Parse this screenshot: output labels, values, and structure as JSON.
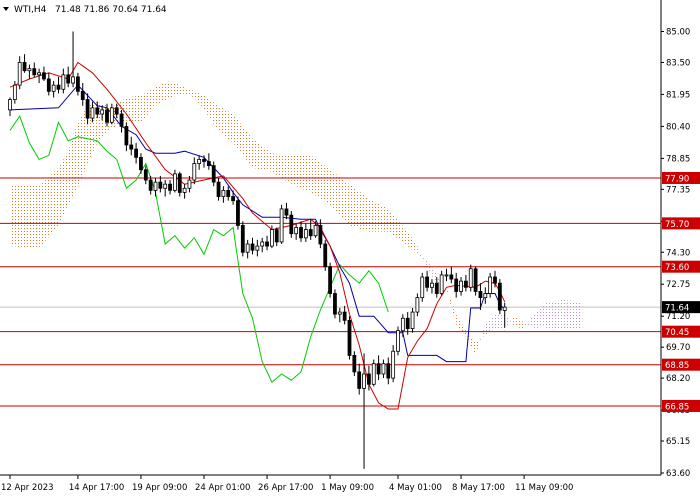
{
  "header": {
    "symbol": "WTI,H4",
    "ohlc": "71.48 71.86 70.64 71.64"
  },
  "chart_data": {
    "type": "candlestick",
    "instrument": "WTI",
    "timeframe": "H4",
    "last_price": 71.64,
    "ylim": [
      63.6,
      85.8
    ],
    "y_ticks": [
      "85.00",
      "83.50",
      "81.95",
      "80.40",
      "78.85",
      "77.35",
      "75.80",
      "74.30",
      "72.75",
      "71.20",
      "69.70",
      "68.20",
      "66.65",
      "65.15",
      "63.60"
    ],
    "x_ticks": [
      {
        "label": "12 Apr 2023",
        "index": 0
      },
      {
        "label": "14 Apr 17:00",
        "index": 14
      },
      {
        "label": "19 Apr 09:00",
        "index": 27
      },
      {
        "label": "24 Apr 01:00",
        "index": 40
      },
      {
        "label": "26 Apr 17:00",
        "index": 53
      },
      {
        "label": "1 May 09:00",
        "index": 66
      },
      {
        "label": "4 May 01:00",
        "index": 80
      },
      {
        "label": "8 May 17:00",
        "index": 93
      },
      {
        "label": "11 May 09:00",
        "index": 106
      }
    ],
    "levels": [
      {
        "value": 77.9,
        "label": "77.90",
        "color": "#cc0000"
      },
      {
        "value": 75.7,
        "label": "75.70",
        "color": "#cc0000"
      },
      {
        "value": 73.6,
        "label": "73.60",
        "color": "#cc0000"
      },
      {
        "value": 70.45,
        "label": "70.45",
        "color": "#cc0000"
      },
      {
        "value": 68.85,
        "label": "68.85",
        "color": "#cc0000"
      },
      {
        "value": 66.85,
        "label": "66.85",
        "color": "#cc0000"
      }
    ],
    "price_label_color": "#000000",
    "candle_color": "#000000",
    "tenkan_color": "#cc0000",
    "kijun_color": "#0000aa",
    "chikou_color": "#00cc00",
    "cloud_bull_color": "#e07820",
    "cloud_bear_color": "#c090c8",
    "candles": [
      [
        81.2,
        81.8,
        80.9,
        81.7
      ],
      [
        81.7,
        82.6,
        81.5,
        82.4
      ],
      [
        82.4,
        83.8,
        82.2,
        83.5
      ],
      [
        83.5,
        83.9,
        83.0,
        83.1
      ],
      [
        83.1,
        83.4,
        82.7,
        83.2
      ],
      [
        83.2,
        83.5,
        82.8,
        82.9
      ],
      [
        82.9,
        83.2,
        82.5,
        83.0
      ],
      [
        83.0,
        83.3,
        82.6,
        82.7
      ],
      [
        82.7,
        83.0,
        81.9,
        82.1
      ],
      [
        82.1,
        82.6,
        81.8,
        82.4
      ],
      [
        82.4,
        82.8,
        82.0,
        82.2
      ],
      [
        82.2,
        83.2,
        82.0,
        82.9
      ],
      [
        82.9,
        83.3,
        82.3,
        82.5
      ],
      [
        82.5,
        85.0,
        82.3,
        82.8
      ],
      [
        82.8,
        83.0,
        81.9,
        82.1
      ],
      [
        82.1,
        82.5,
        81.4,
        81.7
      ],
      [
        81.7,
        82.0,
        80.5,
        80.8
      ],
      [
        80.8,
        81.6,
        80.6,
        81.3
      ],
      [
        81.3,
        81.6,
        80.8,
        81.0
      ],
      [
        81.0,
        81.4,
        80.7,
        81.2
      ],
      [
        81.2,
        81.5,
        80.4,
        80.6
      ],
      [
        80.6,
        81.5,
        80.5,
        81.3
      ],
      [
        81.3,
        81.5,
        80.8,
        81.0
      ],
      [
        81.0,
        81.2,
        80.1,
        80.4
      ],
      [
        80.4,
        80.6,
        79.2,
        79.5
      ],
      [
        79.5,
        79.9,
        79.0,
        79.3
      ],
      [
        79.3,
        79.6,
        78.6,
        78.9
      ],
      [
        78.9,
        79.1,
        78.1,
        78.3
      ],
      [
        78.3,
        78.5,
        77.6,
        77.8
      ],
      [
        77.8,
        78.0,
        77.1,
        77.3
      ],
      [
        77.3,
        77.9,
        77.0,
        77.7
      ],
      [
        77.7,
        78.0,
        77.2,
        77.4
      ],
      [
        77.4,
        77.8,
        77.0,
        77.6
      ],
      [
        77.6,
        77.8,
        77.1,
        77.3
      ],
      [
        77.3,
        78.3,
        77.2,
        78.1
      ],
      [
        78.1,
        78.2,
        77.0,
        77.2
      ],
      [
        77.2,
        77.6,
        76.9,
        77.4
      ],
      [
        77.4,
        78.0,
        77.2,
        77.8
      ],
      [
        77.8,
        78.9,
        77.6,
        78.6
      ],
      [
        78.6,
        79.0,
        78.3,
        78.8
      ],
      [
        78.8,
        79.0,
        78.4,
        78.7
      ],
      [
        78.7,
        79.1,
        78.3,
        78.5
      ],
      [
        78.5,
        78.7,
        77.5,
        77.7
      ],
      [
        77.7,
        77.9,
        76.8,
        77.0
      ],
      [
        77.0,
        77.5,
        76.7,
        77.3
      ],
      [
        77.3,
        77.5,
        76.8,
        77.0
      ],
      [
        77.0,
        77.3,
        76.6,
        76.8
      ],
      [
        76.8,
        77.0,
        75.4,
        75.6
      ],
      [
        75.6,
        75.8,
        74.1,
        74.3
      ],
      [
        74.3,
        74.9,
        74.0,
        74.7
      ],
      [
        74.7,
        75.0,
        74.2,
        74.4
      ],
      [
        74.4,
        74.9,
        74.1,
        74.6
      ],
      [
        74.6,
        75.0,
        74.3,
        74.8
      ],
      [
        74.8,
        75.1,
        74.4,
        74.6
      ],
      [
        74.6,
        75.6,
        74.5,
        75.4
      ],
      [
        75.4,
        75.5,
        74.6,
        74.8
      ],
      [
        74.8,
        76.6,
        74.7,
        76.4
      ],
      [
        76.4,
        76.7,
        75.9,
        76.1
      ],
      [
        76.1,
        76.3,
        75.0,
        75.2
      ],
      [
        75.2,
        75.7,
        74.9,
        75.5
      ],
      [
        75.5,
        75.8,
        74.8,
        75.0
      ],
      [
        75.0,
        75.7,
        74.8,
        75.4
      ],
      [
        75.4,
        75.9,
        74.9,
        75.1
      ],
      [
        75.1,
        75.8,
        75.0,
        75.6
      ],
      [
        75.6,
        75.9,
        74.5,
        74.7
      ],
      [
        74.7,
        74.9,
        73.4,
        73.6
      ],
      [
        73.6,
        73.8,
        72.1,
        72.3
      ],
      [
        72.3,
        72.5,
        71.1,
        71.3
      ],
      [
        71.3,
        71.6,
        70.9,
        71.4
      ],
      [
        71.4,
        71.7,
        70.8,
        71.0
      ],
      [
        71.0,
        71.2,
        69.1,
        69.3
      ],
      [
        69.3,
        69.5,
        68.3,
        68.5
      ],
      [
        68.5,
        68.9,
        67.4,
        67.7
      ],
      [
        67.7,
        69.4,
        63.8,
        68.4
      ],
      [
        68.4,
        68.8,
        67.6,
        67.9
      ],
      [
        67.9,
        69.1,
        67.8,
        68.9
      ],
      [
        68.9,
        69.3,
        68.1,
        68.4
      ],
      [
        68.4,
        69.1,
        68.2,
        68.9
      ],
      [
        68.9,
        69.2,
        67.9,
        68.2
      ],
      [
        68.2,
        69.8,
        68.0,
        69.5
      ],
      [
        69.5,
        70.7,
        69.3,
        70.5
      ],
      [
        70.5,
        71.3,
        70.2,
        71.1
      ],
      [
        71.1,
        71.4,
        70.3,
        70.6
      ],
      [
        70.6,
        71.6,
        70.4,
        71.4
      ],
      [
        71.4,
        72.3,
        71.2,
        72.1
      ],
      [
        72.1,
        73.3,
        71.9,
        73.1
      ],
      [
        73.1,
        73.4,
        72.4,
        72.6
      ],
      [
        72.6,
        73.0,
        72.3,
        72.8
      ],
      [
        72.8,
        73.1,
        72.1,
        72.3
      ],
      [
        72.3,
        73.4,
        72.2,
        73.2
      ],
      [
        73.2,
        73.5,
        72.9,
        73.2
      ],
      [
        73.2,
        73.6,
        72.8,
        73.0
      ],
      [
        73.0,
        73.3,
        72.1,
        72.4
      ],
      [
        72.4,
        73.1,
        72.2,
        72.9
      ],
      [
        72.9,
        73.2,
        72.4,
        72.6
      ],
      [
        72.6,
        73.7,
        72.4,
        73.5
      ],
      [
        73.5,
        73.6,
        72.2,
        72.4
      ],
      [
        72.4,
        72.8,
        71.5,
        72.1
      ],
      [
        72.1,
        72.6,
        71.8,
        72.3
      ],
      [
        72.3,
        73.3,
        72.1,
        73.1
      ],
      [
        73.1,
        73.4,
        72.6,
        72.8
      ],
      [
        72.8,
        73.0,
        71.3,
        71.5
      ],
      [
        71.48,
        71.86,
        70.64,
        71.64
      ]
    ],
    "tenkan": [
      [
        0,
        82.3
      ],
      [
        4,
        82.7
      ],
      [
        8,
        83.0
      ],
      [
        12,
        82.7
      ],
      [
        14,
        83.5
      ],
      [
        17,
        83.0
      ],
      [
        20,
        82.2
      ],
      [
        24,
        81.0
      ],
      [
        28,
        79.6
      ],
      [
        32,
        78.3
      ],
      [
        36,
        77.6
      ],
      [
        40,
        77.8
      ],
      [
        44,
        78.0
      ],
      [
        48,
        76.9
      ],
      [
        50,
        76.2
      ],
      [
        54,
        75.4
      ],
      [
        58,
        75.6
      ],
      [
        62,
        75.9
      ],
      [
        64,
        75.5
      ],
      [
        66,
        74.6
      ],
      [
        68,
        73.3
      ],
      [
        70,
        71.3
      ],
      [
        72,
        69.8
      ],
      [
        74,
        67.9
      ],
      [
        76,
        67.0
      ],
      [
        78,
        66.7
      ],
      [
        80,
        66.7
      ],
      [
        82,
        69.2
      ],
      [
        84,
        70.0
      ],
      [
        86,
        70.6
      ],
      [
        88,
        71.8
      ],
      [
        90,
        72.6
      ],
      [
        92,
        72.7
      ],
      [
        96,
        72.6
      ],
      [
        98,
        72.9
      ],
      [
        100,
        72.8
      ],
      [
        101,
        72.4
      ],
      [
        102,
        71.9
      ]
    ],
    "kijun": [
      [
        0,
        81.2
      ],
      [
        10,
        81.3
      ],
      [
        14,
        82.4
      ],
      [
        18,
        81.4
      ],
      [
        20,
        81.3
      ],
      [
        23,
        80.4
      ],
      [
        26,
        80.0
      ],
      [
        28,
        79.3
      ],
      [
        30,
        79.1
      ],
      [
        34,
        79.1
      ],
      [
        36,
        79.2
      ],
      [
        40,
        78.9
      ],
      [
        44,
        77.9
      ],
      [
        46,
        77.2
      ],
      [
        48,
        76.6
      ],
      [
        52,
        76.0
      ],
      [
        56,
        76.0
      ],
      [
        60,
        75.9
      ],
      [
        63,
        75.9
      ],
      [
        64,
        75.4
      ],
      [
        66,
        74.6
      ],
      [
        68,
        73.6
      ],
      [
        70,
        72.8
      ],
      [
        72,
        71.2
      ],
      [
        75,
        71.2
      ],
      [
        78,
        70.4
      ],
      [
        81,
        70.4
      ],
      [
        82,
        69.3
      ],
      [
        88,
        69.3
      ],
      [
        90,
        69.0
      ],
      [
        94,
        69.0
      ],
      [
        95,
        71.6
      ],
      [
        97,
        71.6
      ],
      [
        98,
        72.3
      ],
      [
        100,
        72.3
      ],
      [
        101,
        71.8
      ],
      [
        102,
        71.5
      ]
    ],
    "chikou": [
      [
        0,
        80.2
      ],
      [
        2,
        80.9
      ],
      [
        4,
        79.6
      ],
      [
        6,
        78.8
      ],
      [
        8,
        79.0
      ],
      [
        10,
        80.6
      ],
      [
        12,
        79.7
      ],
      [
        14,
        79.9
      ],
      [
        16,
        79.8
      ],
      [
        18,
        79.7
      ],
      [
        20,
        79.2
      ],
      [
        22,
        78.8
      ],
      [
        24,
        77.4
      ],
      [
        26,
        77.8
      ],
      [
        28,
        78.6
      ],
      [
        30,
        77.2
      ],
      [
        32,
        74.7
      ],
      [
        34,
        75.1
      ],
      [
        36,
        74.5
      ],
      [
        38,
        75.0
      ],
      [
        40,
        74.2
      ],
      [
        42,
        75.4
      ],
      [
        44,
        75.1
      ],
      [
        46,
        75.5
      ],
      [
        48,
        72.3
      ],
      [
        50,
        71.1
      ],
      [
        52,
        69.0
      ],
      [
        54,
        68.0
      ],
      [
        56,
        68.4
      ],
      [
        58,
        68.1
      ],
      [
        60,
        68.5
      ],
      [
        62,
        70.2
      ],
      [
        64,
        71.5
      ],
      [
        66,
        72.6
      ],
      [
        68,
        73.7
      ],
      [
        70,
        73.2
      ],
      [
        72,
        72.8
      ],
      [
        74,
        73.4
      ],
      [
        76,
        72.8
      ],
      [
        78,
        71.4
      ]
    ],
    "cloud": [
      [
        0,
        77.6,
        74.6
      ],
      [
        6,
        77.5,
        74.5
      ],
      [
        10,
        78.4,
        75.6
      ],
      [
        12,
        79.2,
        76.6
      ],
      [
        14,
        80.6,
        77.4
      ],
      [
        16,
        81.4,
        78.6
      ],
      [
        18,
        81.6,
        79.6
      ],
      [
        21,
        81.3,
        80.3
      ],
      [
        24,
        81.8,
        80.6
      ],
      [
        27,
        81.9,
        80.6
      ],
      [
        30,
        82.3,
        81.4
      ],
      [
        33,
        82.6,
        81.8
      ],
      [
        36,
        82.3,
        82.0
      ],
      [
        38,
        82.1,
        81.8
      ],
      [
        40,
        81.9,
        81.2
      ],
      [
        43,
        81.4,
        80.2
      ],
      [
        46,
        81.0,
        79.6
      ],
      [
        50,
        79.8,
        78.4
      ],
      [
        54,
        79.1,
        78.2
      ],
      [
        58,
        79.0,
        77.6
      ],
      [
        62,
        79.0,
        77.2
      ],
      [
        66,
        78.3,
        76.6
      ],
      [
        70,
        77.6,
        75.6
      ],
      [
        74,
        76.9,
        75.3
      ],
      [
        78,
        76.4,
        75.3
      ],
      [
        82,
        75.3,
        74.6
      ],
      [
        84,
        74.6,
        74.2
      ],
      [
        86,
        73.5,
        73.9
      ],
      [
        88,
        72.8,
        73.2
      ],
      [
        90,
        72.6,
        72.5
      ],
      [
        92,
        71.3,
        70.8
      ],
      [
        94,
        70.5,
        70.2
      ],
      [
        96,
        69.9,
        69.3
      ],
      [
        98,
        70.3,
        70.8
      ],
      [
        100,
        70.6,
        71.3
      ],
      [
        102,
        70.5,
        71.3
      ],
      [
        104,
        71.2,
        70.7
      ],
      [
        106,
        70.9,
        70.6
      ],
      [
        108,
        70.6,
        71.3
      ],
      [
        110,
        70.7,
        71.8
      ],
      [
        112,
        70.5,
        71.9
      ],
      [
        114,
        70.6,
        72.0
      ],
      [
        118,
        70.6,
        71.9
      ]
    ]
  }
}
